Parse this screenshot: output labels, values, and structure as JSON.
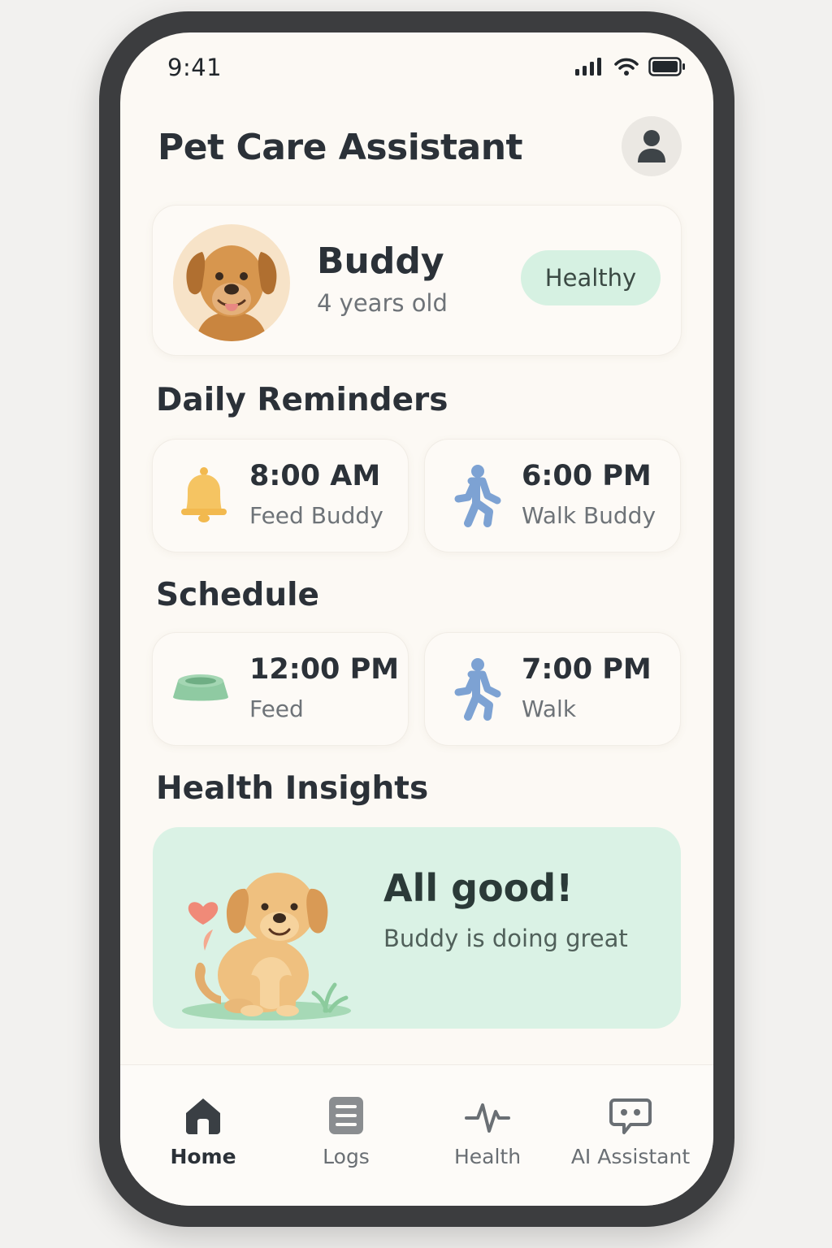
{
  "status_bar": {
    "time": "9:41"
  },
  "header": {
    "title": "Pet Care Assistant"
  },
  "pet": {
    "name": "Buddy",
    "age": "4 years old",
    "status": "Healthy"
  },
  "reminders": {
    "title": "Daily Reminders",
    "items": [
      {
        "time": "8:00 AM",
        "label": "Feed Buddy",
        "icon": "bell-icon"
      },
      {
        "time": "6:00 PM",
        "label": "Walk Buddy",
        "icon": "walking-person-icon"
      }
    ]
  },
  "schedule": {
    "title": "Schedule",
    "items": [
      {
        "time": "12:00 PM",
        "label": "Feed",
        "icon": "food-bowl-icon"
      },
      {
        "time": "7:00 PM",
        "label": "Walk",
        "icon": "walking-person-icon"
      }
    ]
  },
  "insights": {
    "title": "Health Insights",
    "headline": "All good!",
    "message": "Buddy is doing great"
  },
  "tabs": [
    {
      "label": "Home",
      "icon": "home-icon",
      "active": true
    },
    {
      "label": "Logs",
      "icon": "list-icon",
      "active": false
    },
    {
      "label": "Health",
      "icon": "pulse-icon",
      "active": false
    },
    {
      "label": "AI Assistant",
      "icon": "chat-bot-icon",
      "active": false
    }
  ],
  "colors": {
    "background": "#fcf9f4",
    "healthy_badge": "#d6f1e2",
    "insight_card": "#daf2e5",
    "bell": "#f5c462",
    "walk": "#7da2d3",
    "bowl": "#8fcaa2"
  }
}
